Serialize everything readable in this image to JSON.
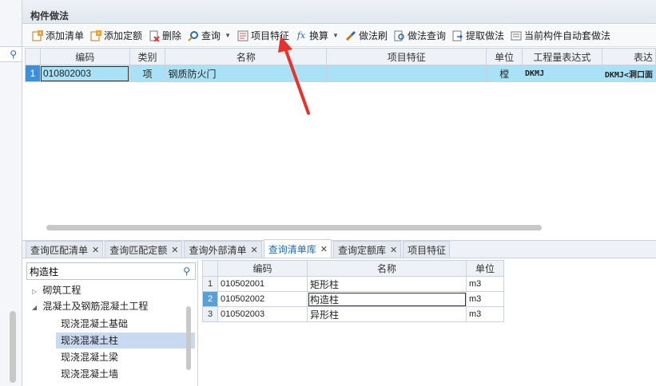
{
  "panel": {
    "title": "构件做法"
  },
  "toolbar": {
    "items": [
      {
        "label": "添加清单",
        "icon": "add-list-icon"
      },
      {
        "label": "添加定额",
        "icon": "add-quota-icon"
      },
      {
        "label": "删除",
        "icon": "delete-icon"
      },
      {
        "label": "查询",
        "icon": "query-icon"
      },
      {
        "label": "项目特征",
        "icon": "item-feature-icon"
      },
      {
        "label": "换算",
        "icon": "fx-icon"
      },
      {
        "label": "做法刷",
        "icon": "brush-icon"
      },
      {
        "label": "做法查询",
        "icon": "method-query-icon"
      },
      {
        "label": "提取做法",
        "icon": "extract-icon"
      },
      {
        "label": "当前构件自动套做法",
        "icon": "auto-apply-icon"
      }
    ]
  },
  "main_grid": {
    "columns": [
      "编码",
      "类别",
      "名称",
      "项目特征",
      "单位",
      "工程量表达式",
      "表达"
    ],
    "rows": [
      {
        "num": "1",
        "code": "010802003",
        "category": "项",
        "name": "钢质防火门",
        "feature": "",
        "unit": "樘",
        "expr": "DKMJ",
        "expr2": "DKMJ<洞口面"
      }
    ]
  },
  "tabs": [
    {
      "label": "查询匹配清单"
    },
    {
      "label": "查询匹配定额"
    },
    {
      "label": "查询外部清单"
    },
    {
      "label": "查询清单库"
    },
    {
      "label": "查询定额库"
    },
    {
      "label": "项目特征"
    }
  ],
  "tree": {
    "search_value": "构造柱",
    "items": [
      {
        "label": "砌筑工程",
        "level": 0,
        "expander": "▷"
      },
      {
        "label": "混凝土及钢筋混凝土工程",
        "level": 0,
        "expander": "◢"
      },
      {
        "label": "现浇混凝土基础",
        "level": 1,
        "expander": ""
      },
      {
        "label": "现浇混凝土柱",
        "level": 1,
        "expander": ""
      },
      {
        "label": "现浇混凝土梁",
        "level": 1,
        "expander": ""
      },
      {
        "label": "现浇混凝土墙",
        "level": 1,
        "expander": ""
      }
    ]
  },
  "result_grid": {
    "columns": [
      "编码",
      "名称",
      "单位"
    ],
    "rows": [
      {
        "num": "1",
        "code": "010502001",
        "name": "矩形柱",
        "unit": "m3"
      },
      {
        "num": "2",
        "code": "010502002",
        "name": "构造柱",
        "unit": "m3"
      },
      {
        "num": "3",
        "code": "010502003",
        "name": "异形柱",
        "unit": "m3"
      }
    ]
  },
  "colors": {
    "selected_row": "#a9e2f6",
    "header_selected": "#5aa0d8",
    "accent_tab": "#1b6ec2",
    "annotation_arrow": "#e8312a"
  }
}
